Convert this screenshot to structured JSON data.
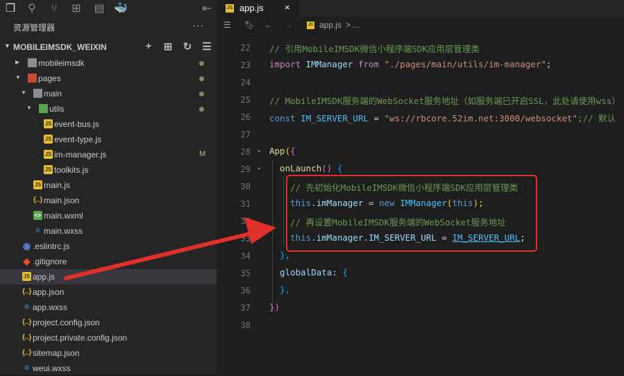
{
  "activity_bar": {
    "icons": [
      "files-icon",
      "search-icon",
      "source-control-icon",
      "extensions-icon",
      "layout-icon",
      "docker-icon"
    ],
    "collapse": "collapse-panel-icon"
  },
  "explorer": {
    "title": "资源管理器",
    "more": "···",
    "project": "MOBILEIMSDK_WEIXIN",
    "tree": [
      {
        "label": "mobileimsdk",
        "type": "folder",
        "depth": 0,
        "state": "collapsed",
        "modified": true
      },
      {
        "label": "pages",
        "type": "folder-red",
        "depth": 0,
        "state": "expanded",
        "modified": true
      },
      {
        "label": "main",
        "type": "folder",
        "depth": 1,
        "state": "expanded",
        "modified": true
      },
      {
        "label": "utils",
        "type": "folder-green",
        "depth": 2,
        "state": "expanded",
        "modified": true
      },
      {
        "label": "event-bus.js",
        "type": "js",
        "depth": 3
      },
      {
        "label": "event-type.js",
        "type": "js",
        "depth": 3
      },
      {
        "label": "im-manager.js",
        "type": "js",
        "depth": 3,
        "badge": "M"
      },
      {
        "label": "toolkits.js",
        "type": "js",
        "depth": 3
      },
      {
        "label": "main.js",
        "type": "js",
        "depth": 2
      },
      {
        "label": "main.json",
        "type": "json",
        "depth": 2
      },
      {
        "label": "main.wxml",
        "type": "wxml",
        "depth": 2
      },
      {
        "label": "main.wxss",
        "type": "wxss",
        "depth": 2
      },
      {
        "label": ".eslintrc.js",
        "type": "eslint",
        "depth": 1
      },
      {
        "label": ".gitignore",
        "type": "git",
        "depth": 1
      },
      {
        "label": "app.js",
        "type": "js",
        "depth": 1,
        "selected": true
      },
      {
        "label": "app.json",
        "type": "json",
        "depth": 1
      },
      {
        "label": "app.wxss",
        "type": "wxss",
        "depth": 1
      },
      {
        "label": "project.config.json",
        "type": "json",
        "depth": 1
      },
      {
        "label": "project.private.config.json",
        "type": "json",
        "depth": 1
      },
      {
        "label": "sitemap.json",
        "type": "json",
        "depth": 1
      },
      {
        "label": "weui.wxss",
        "type": "wxss",
        "depth": 1
      }
    ]
  },
  "editor": {
    "tab": {
      "label": "app.js",
      "close": "×"
    },
    "breadcrumb": {
      "file": "app.js",
      "rest": "> ..."
    },
    "lines": [
      {
        "n": "22",
        "t": [
          [
            "// 引用MobileIMSDK微信小程序端SDK应用层管理类",
            "c"
          ]
        ]
      },
      {
        "n": "23",
        "t": [
          [
            "import",
            "n"
          ],
          [
            " IMManager ",
            "v"
          ],
          [
            "from",
            "n"
          ],
          [
            " \"./pages/main/utils/im-manager\"",
            "s"
          ],
          [
            ";",
            "t2"
          ]
        ]
      },
      {
        "n": "24",
        "t": []
      },
      {
        "n": "25",
        "t": [
          [
            "// MobileIMSDK服务端的WebSocket服务地址（如服务端已开启SSL，此处请使用wss）",
            "c"
          ]
        ]
      },
      {
        "n": "26",
        "t": [
          [
            "const",
            "k"
          ],
          [
            " IM_SERVER_URL ",
            "kc"
          ],
          [
            "= ",
            "t2"
          ],
          [
            "\"ws://rbcore.52im.net:3000/websocket\"",
            "s"
          ],
          [
            ";// 默认",
            "c"
          ]
        ]
      },
      {
        "n": "27",
        "t": []
      },
      {
        "n": "28",
        "fold": true,
        "t": [
          [
            "App",
            "f"
          ],
          [
            "(",
            "y"
          ],
          [
            "{",
            "p"
          ]
        ]
      },
      {
        "n": "29",
        "fold": true,
        "t": [
          [
            "  onLaunch",
            "f"
          ],
          [
            "() ",
            "p"
          ],
          [
            "{",
            "b"
          ]
        ]
      },
      {
        "n": "30",
        "t": [
          [
            "    // 先初始化MobileIMSDK微信小程序端SDK应用层管理类",
            "c"
          ]
        ]
      },
      {
        "n": "31",
        "t": [
          [
            "    this",
            "k"
          ],
          [
            ".imManager ",
            "v"
          ],
          [
            "= ",
            "t2"
          ],
          [
            "new ",
            "k"
          ],
          [
            "IMManager",
            "kc"
          ],
          [
            "(",
            "y"
          ],
          [
            "this",
            "k"
          ],
          [
            ");",
            "y"
          ]
        ]
      },
      {
        "n": "32",
        "t": [
          [
            "    // 再设置MobileIMSDK服务端的WebSocket服务地址",
            "c"
          ]
        ]
      },
      {
        "n": "33",
        "t": [
          [
            "    this",
            "k"
          ],
          [
            ".imManager.IM_SERVER_URL ",
            "v"
          ],
          [
            "= ",
            "t2"
          ],
          [
            "IM_SERVER_URL",
            "u"
          ],
          [
            ";",
            "t2"
          ]
        ]
      },
      {
        "n": "34",
        "t": [
          [
            "  },",
            "b"
          ]
        ]
      },
      {
        "n": "35",
        "t": [
          [
            "  globalData",
            "v"
          ],
          [
            ": ",
            "t2"
          ],
          [
            "{",
            "b"
          ]
        ]
      },
      {
        "n": "36",
        "t": [
          [
            "  },",
            "b"
          ]
        ]
      },
      {
        "n": "37",
        "t": [
          [
            "})",
            "p"
          ]
        ]
      },
      {
        "n": "38",
        "t": []
      }
    ]
  },
  "annotation": {
    "color": "#e0302a"
  }
}
